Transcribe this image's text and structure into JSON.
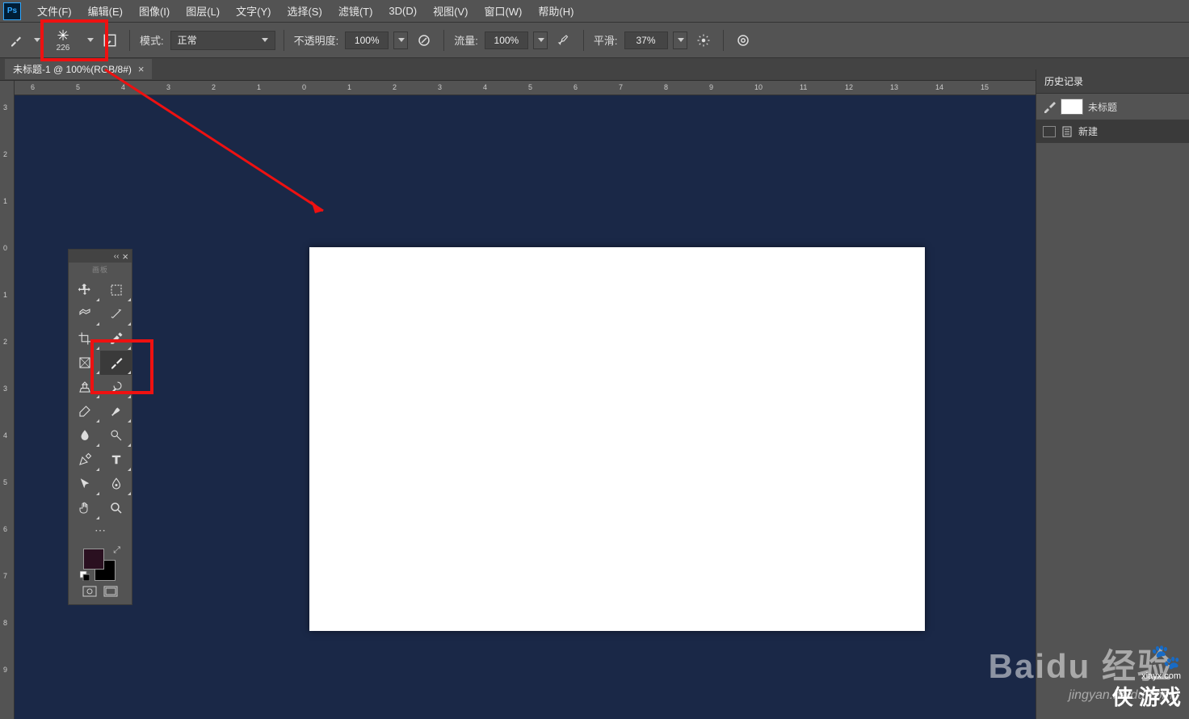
{
  "app_logo": "Ps",
  "menu": [
    "文件(F)",
    "编辑(E)",
    "图像(I)",
    "图层(L)",
    "文字(Y)",
    "选择(S)",
    "滤镜(T)",
    "3D(D)",
    "视图(V)",
    "窗口(W)",
    "帮助(H)"
  ],
  "options": {
    "brush_size": "226",
    "mode_label": "模式:",
    "mode_value": "正常",
    "opacity_label": "不透明度:",
    "opacity_value": "100%",
    "flow_label": "流量:",
    "flow_value": "100%",
    "smoothing_label": "平滑:",
    "smoothing_value": "37%"
  },
  "doc_tab": {
    "title": "未标题-1 @ 100%(RGB/8#)"
  },
  "ruler_h": [
    "6",
    "5",
    "4",
    "3",
    "2",
    "1",
    "0",
    "1",
    "2",
    "3",
    "4",
    "5",
    "6",
    "7",
    "8",
    "9",
    "10",
    "11",
    "12",
    "13",
    "14",
    "15"
  ],
  "ruler_v": [
    "3",
    "2",
    "1",
    "0",
    "1",
    "2",
    "3",
    "4",
    "5",
    "6",
    "7",
    "8",
    "9"
  ],
  "tools_panel": {
    "collapse": "‹‹",
    "title": "画板"
  },
  "right_panel": {
    "tab": "历史记录",
    "rows": [
      {
        "label": "未标题"
      },
      {
        "label": "新建"
      }
    ]
  },
  "watermark": {
    "big": "Baidu 经验",
    "sub": "jingyan.baidu.com"
  },
  "corner": {
    "t1": "侠 游戏",
    "t2": "xiayx.com"
  }
}
